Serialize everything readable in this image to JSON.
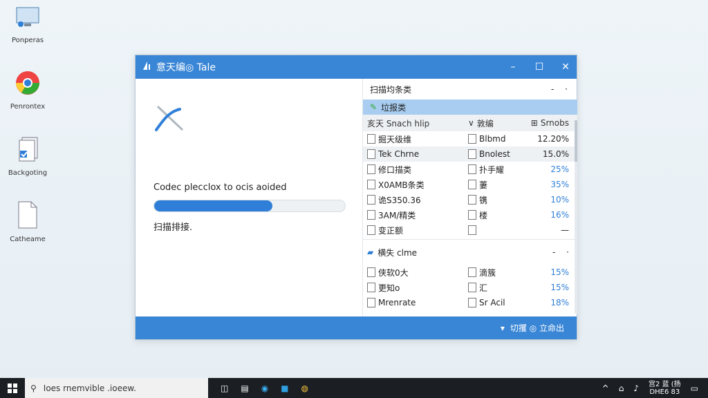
{
  "desktop": {
    "icons": [
      {
        "label": "Ponperas"
      },
      {
        "label": "Penrontex"
      },
      {
        "label": "Backgoting"
      },
      {
        "label": "Catheame"
      }
    ]
  },
  "window": {
    "title": "意天编◎ Tale",
    "status_text": "Codec plecclox to ocis aoided",
    "progress": 0.62,
    "sub_text": "扫描排接.",
    "right": {
      "header_label": "扫描均条类",
      "header_dash": "- ·",
      "selected_label": "垃报类",
      "columns": {
        "a": "亥天 Snach hlip",
        "b": "敦编",
        "c": "Srnobs"
      },
      "rows": [
        {
          "a": "掘天级维",
          "b": "Blbmd",
          "c": "12.20%",
          "alt": false,
          "tall": false,
          "dark": true
        },
        {
          "a": "Tek Chrne",
          "b": "Bnolest",
          "c": "15.0%",
          "alt": true,
          "tall": false,
          "dark": true
        },
        {
          "a": "修口描类",
          "b": "扑手耀",
          "c": "25%",
          "alt": false,
          "tall": false,
          "dark": false
        },
        {
          "a": "X0AMB条类",
          "b": "萋",
          "c": "35%",
          "alt": false,
          "tall": false,
          "dark": false
        },
        {
          "a": "诡S350.36",
          "b": "镌",
          "c": "10%",
          "alt": false,
          "tall": false,
          "dark": false
        },
        {
          "a": "3AM/精类",
          "b": "楼",
          "c": "16%",
          "alt": false,
          "tall": false,
          "dark": false
        },
        {
          "a": "变正额",
          "b": "",
          "c": "—",
          "alt": false,
          "tall": false,
          "dark": true
        }
      ],
      "section2": {
        "label": "横失 clme",
        "dash": "- ·"
      },
      "rows2": [
        {
          "a": "侠软0大",
          "b": "滴簇",
          "c": "15%"
        },
        {
          "a": "更知o",
          "b": "汇",
          "c": "15%"
        },
        {
          "a": "Mrenrate",
          "b": "Sr Acil",
          "c": "18%"
        }
      ]
    },
    "bottom_action": "切攫 ◎ 立命出"
  },
  "taskbar": {
    "search_placeholder": "Ioes rnemvible .ioeew.",
    "clock_time": "宫2 蓝 (扬",
    "clock_date": "DHE6 83"
  },
  "colors": {
    "accent": "#3a86d6",
    "progress": "#2f7fd8",
    "selected_row": "#a8cdf0"
  }
}
